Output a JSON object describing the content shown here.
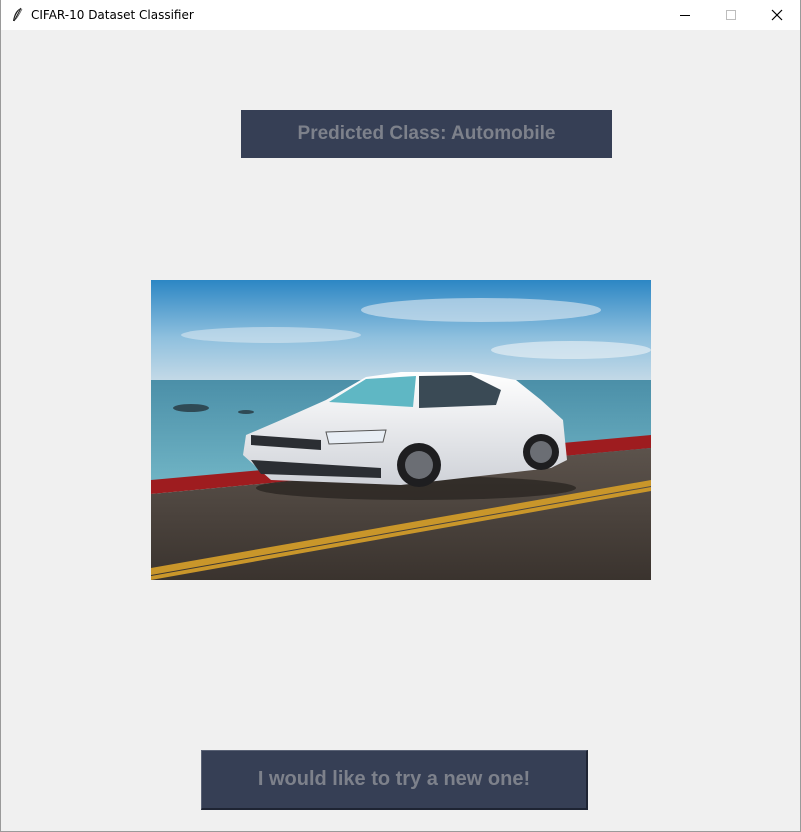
{
  "window": {
    "title": "CIFAR-10 Dataset Classifier",
    "icon": "feather-icon",
    "controls": [
      "minimize-icon",
      "maximize-icon",
      "close-icon"
    ]
  },
  "prediction": {
    "label": "Predicted Class: Automobile",
    "background": "#363f55",
    "text_color": "#7d818b"
  },
  "image": {
    "subject": "car-photo"
  },
  "action_button": {
    "label": "I would like to try a new one!",
    "background": "#363f55",
    "text_color": "#7d818b"
  }
}
